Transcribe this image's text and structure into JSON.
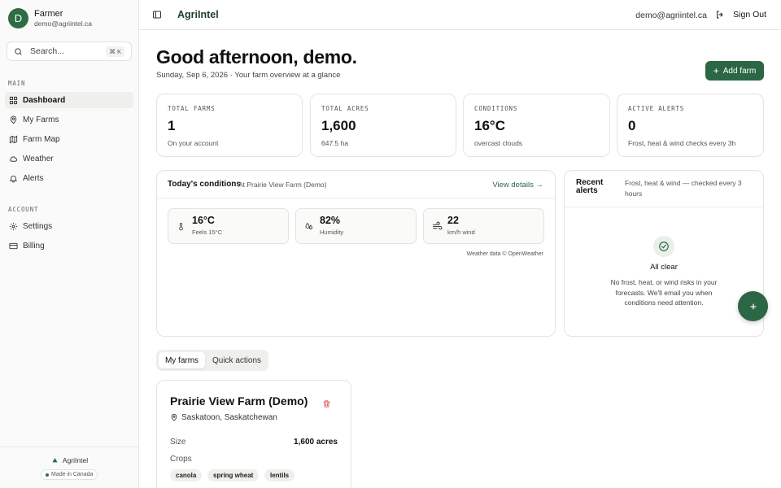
{
  "user": {
    "initial": "D",
    "name": "Farmer",
    "email": "demo@agriintel.ca"
  },
  "search": {
    "label": "Search...",
    "shortcut": "⌘ K"
  },
  "sidebar": {
    "main_label": "MAIN",
    "main_items": [
      {
        "label": "Dashboard",
        "icon": "grid-icon",
        "active": true
      },
      {
        "label": "My Farms",
        "icon": "map-pin-icon"
      },
      {
        "label": "Farm Map",
        "icon": "map-icon"
      },
      {
        "label": "Weather",
        "icon": "cloud-icon"
      },
      {
        "label": "Alerts",
        "icon": "bell-icon"
      }
    ],
    "account_label": "ACCOUNT",
    "account_items": [
      {
        "label": "Settings",
        "icon": "gear-icon"
      },
      {
        "label": "Billing",
        "icon": "credit-card-icon"
      }
    ],
    "footer_brand": "AgriIntel",
    "footer_badge": "Made in Canada"
  },
  "topbar": {
    "logo": "AgriIntel",
    "email": "demo@agriintel.ca",
    "signout": "Sign Out"
  },
  "greeting": {
    "title": "Good afternoon, demo.",
    "subtitle": "Sunday, Sep 6, 2026 · Your farm overview at a glance"
  },
  "add_farm": "Add farm",
  "stats": [
    {
      "label": "TOTAL FARMS",
      "value": "1",
      "sub": "On your account"
    },
    {
      "label": "TOTAL ACRES",
      "value": "1,600",
      "sub": "647.5 ha"
    },
    {
      "label": "CONDITIONS",
      "value": "16°C",
      "sub": "overcast clouds"
    },
    {
      "label": "ACTIVE ALERTS",
      "value": "0",
      "sub": "Frost, heat & wind checks every 3h"
    }
  ],
  "conditions": {
    "title": "Today's conditions",
    "location": "At Prairie View Farm (Demo)",
    "view_details": "View details →",
    "metrics": [
      {
        "value": "16°C",
        "sub": "Feels 15°C",
        "icon": "thermometer-icon"
      },
      {
        "value": "82%",
        "sub": "Humidity",
        "icon": "droplets-icon"
      },
      {
        "value": "22",
        "sub": "km/h wind",
        "icon": "wind-icon"
      }
    ],
    "attribution": "Weather data © OpenWeather"
  },
  "alerts": {
    "title": "Recent alerts",
    "subtitle": "Frost, heat & wind — checked every 3 hours",
    "empty_title": "All clear",
    "empty_message": "No frost, heat, or wind risks in your forecasts. We'll email you when conditions need attention."
  },
  "tabs": [
    {
      "label": "My farms",
      "active": true
    },
    {
      "label": "Quick actions"
    }
  ],
  "farm": {
    "name": "Prairie View Farm (Demo)",
    "location": "Saskatoon, Saskatchewan",
    "size_label": "Size",
    "size_value": "1,600 acres",
    "crops_label": "Crops",
    "crops": [
      "canola",
      "spring wheat",
      "lentils"
    ]
  },
  "colors": {
    "brand": "#2b6645",
    "avatar": "#2f6b44",
    "alert_red": "#d9534f"
  }
}
